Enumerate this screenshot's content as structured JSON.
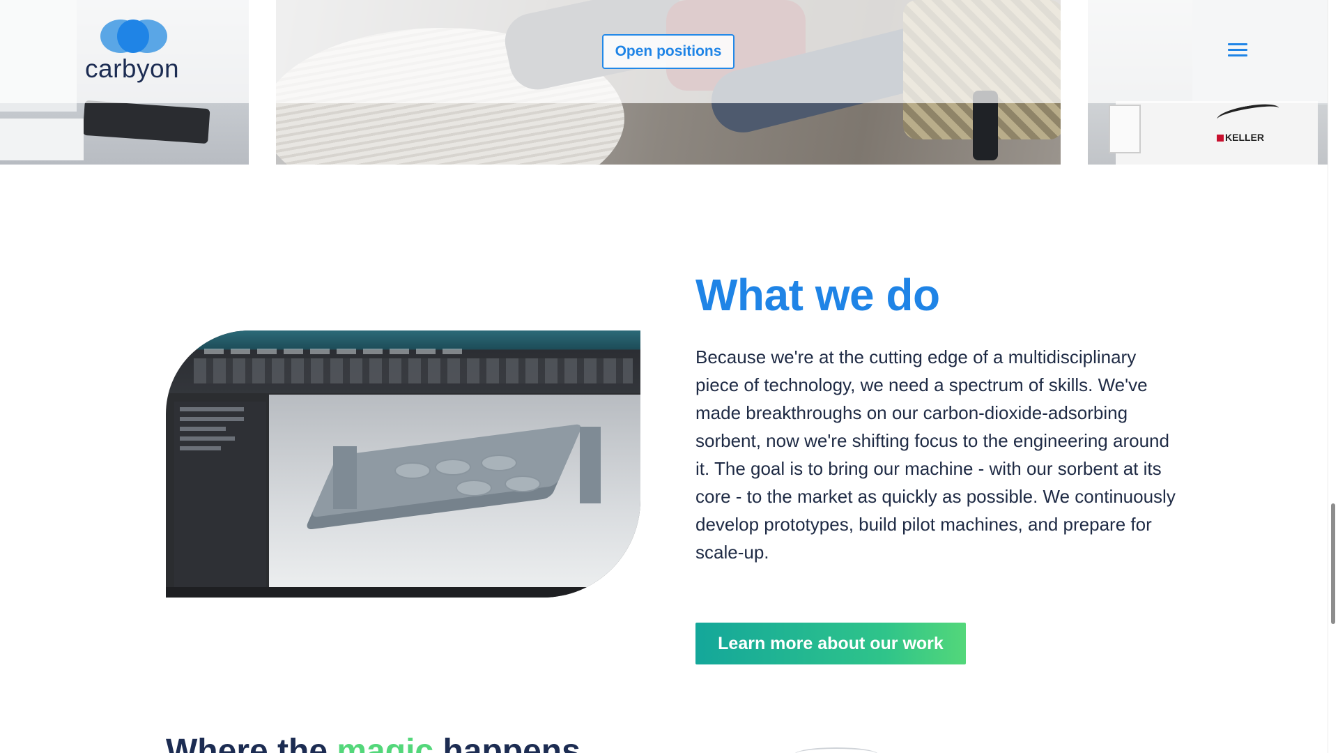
{
  "header": {
    "logo_text": "carbyon",
    "open_positions_label": "Open positions",
    "menu_icon": "hamburger-menu-icon"
  },
  "photos": {
    "right_brand_text": "KELLER"
  },
  "what_we_do": {
    "title": "What we do",
    "body": "Because we're at the cutting edge of a multidisciplinary piece of technology, we need a spectrum of skills. We've made breakthroughs on our carbon-dioxide-adsorbing sorbent, now we're shifting focus to the engineering around it. The goal is to bring our machine - with our sorbent at its core - to the market as quickly as possible. We continuously develop prototypes, build pilot machines, and prepare for scale-up.",
    "cta_label": "Learn more about our work"
  },
  "next_section": {
    "title_before": "Where the ",
    "title_accent": "magic",
    "title_after": " happens"
  },
  "colors": {
    "brand_blue": "#1f84e6",
    "navy": "#1c2c52",
    "cta_gradient_start": "#14a79a",
    "cta_gradient_end": "#53d77a"
  }
}
